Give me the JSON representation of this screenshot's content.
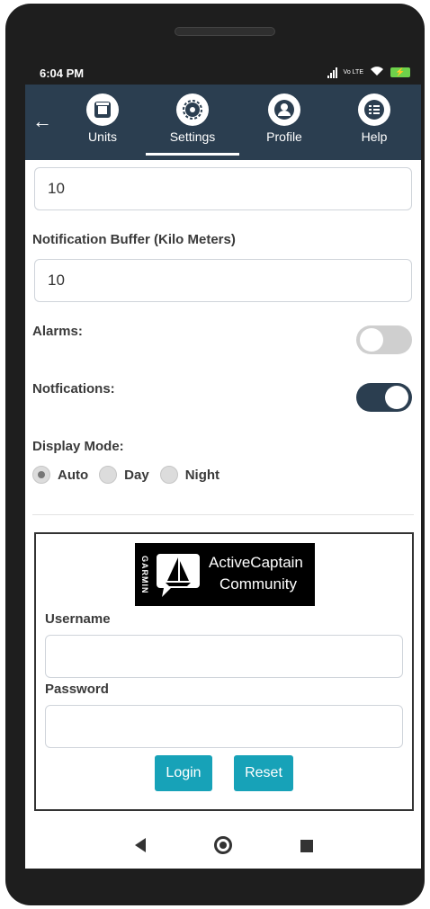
{
  "status_bar": {
    "time": "6:04 PM",
    "network": "Vo LTE",
    "battery_icon": "battery-charging-icon"
  },
  "app_bar": {
    "back_icon": "back-arrow-icon",
    "tabs": [
      {
        "label": "Units",
        "icon": "units-icon",
        "selected": false
      },
      {
        "label": "Settings",
        "icon": "gear-icon",
        "selected": true
      },
      {
        "label": "Profile",
        "icon": "profile-icon",
        "selected": false
      },
      {
        "label": "Help",
        "icon": "list-icon",
        "selected": false
      }
    ],
    "background": "#2b3e50"
  },
  "settings": {
    "top_field_value": "10",
    "notification_buffer_label": "Notification Buffer (Kilo Meters)",
    "notification_buffer_value": "10",
    "alarms_label": "Alarms:",
    "alarms_on": false,
    "notifications_label": "Notfications:",
    "notifications_on": true,
    "display_mode_label": "Display Mode:",
    "display_mode_options": [
      "Auto",
      "Day",
      "Night"
    ],
    "display_mode_selected": "Auto"
  },
  "login": {
    "logo_brand": "GARMIN",
    "logo_line1": "ActiveCaptain",
    "logo_line2": "Community",
    "username_label": "Username",
    "username_value": "",
    "password_label": "Password",
    "password_value": "",
    "login_button": "Login",
    "reset_button": "Reset",
    "button_color": "#17a2b8"
  },
  "nav_bar": {
    "back": "nav-back-icon",
    "home": "nav-home-icon",
    "recent": "nav-recent-icon"
  }
}
